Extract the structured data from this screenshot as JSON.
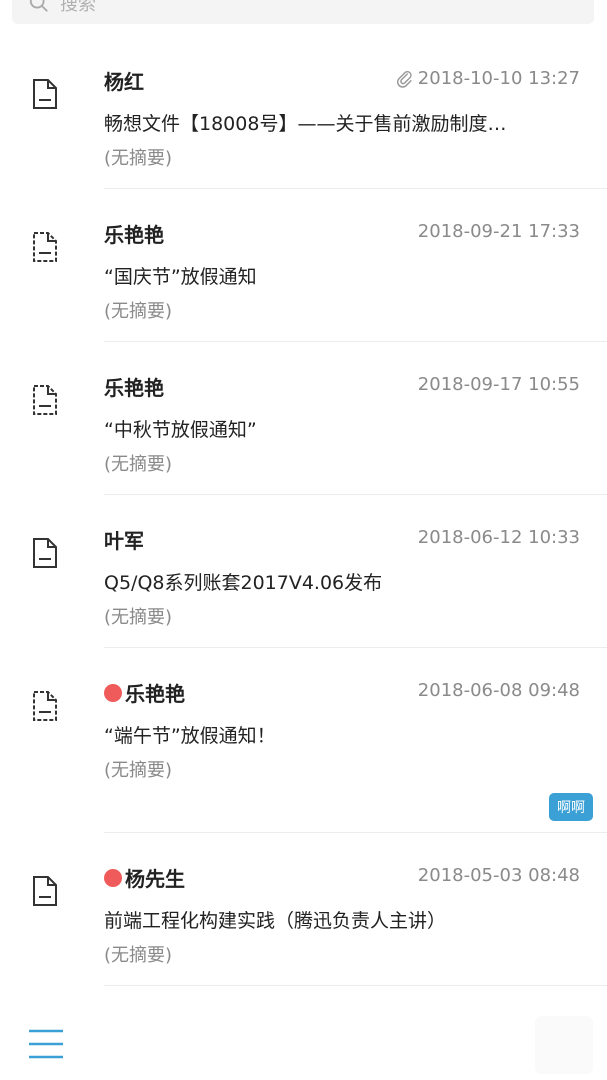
{
  "search": {
    "placeholder": "搜索",
    "icon": "search-icon"
  },
  "messages": [
    {
      "sender": "杨红",
      "date": "2018-10-10 13:27",
      "subject": "畅想文件【18008号】——关于售前激励制度…",
      "summary": "(无摘要)",
      "unread": false,
      "attachment": true,
      "tag": ""
    },
    {
      "sender": "乐艳艳",
      "date": "2018-09-21 17:33",
      "subject": "“国庆节”放假通知",
      "summary": "(无摘要)",
      "unread": false,
      "attachment": false,
      "tag": ""
    },
    {
      "sender": "乐艳艳",
      "date": "2018-09-17 10:55",
      "subject": "“中秋节放假通知”",
      "summary": "(无摘要)",
      "unread": false,
      "attachment": false,
      "tag": ""
    },
    {
      "sender": "叶军",
      "date": "2018-06-12 10:33",
      "subject": "Q5/Q8系列账套2017V4.06发布",
      "summary": "(无摘要)",
      "unread": false,
      "attachment": false,
      "tag": ""
    },
    {
      "sender": "乐艳艳",
      "date": "2018-06-08 09:48",
      "subject": "“端午节”放假通知！",
      "summary": "(无摘要)",
      "unread": true,
      "attachment": false,
      "tag": "啊啊"
    },
    {
      "sender": "杨先生",
      "date": "2018-05-03 08:48",
      "subject": "前端工程化构建实践（腾迅负责人主讲）",
      "summary": "(无摘要)",
      "unread": true,
      "attachment": false,
      "tag": ""
    }
  ],
  "colors": {
    "unread_dot": "#ef5b5b",
    "tag_bg": "#3ba0d6",
    "menu": "#3ba0d6"
  },
  "footer": {
    "menu_icon": "hamburger-menu-icon"
  }
}
